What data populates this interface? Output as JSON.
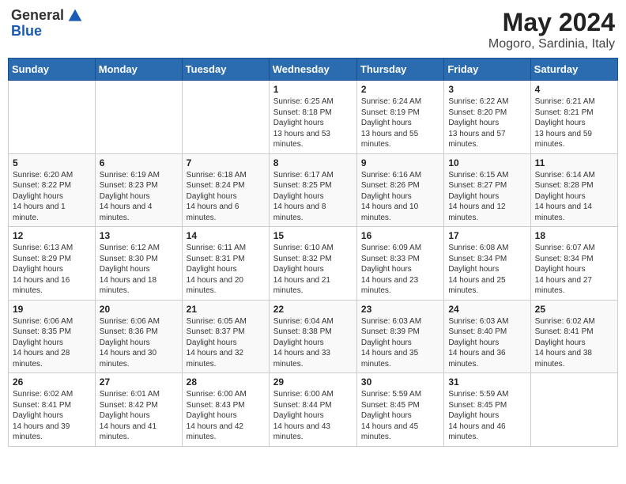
{
  "logo": {
    "general": "General",
    "blue": "Blue"
  },
  "title": {
    "month": "May 2024",
    "location": "Mogoro, Sardinia, Italy"
  },
  "days_of_week": [
    "Sunday",
    "Monday",
    "Tuesday",
    "Wednesday",
    "Thursday",
    "Friday",
    "Saturday"
  ],
  "weeks": [
    [
      {
        "day": null,
        "data": null
      },
      {
        "day": null,
        "data": null
      },
      {
        "day": null,
        "data": null
      },
      {
        "day": "1",
        "data": {
          "sunrise": "6:25 AM",
          "sunset": "8:18 PM",
          "daylight": "13 hours and 53 minutes."
        }
      },
      {
        "day": "2",
        "data": {
          "sunrise": "6:24 AM",
          "sunset": "8:19 PM",
          "daylight": "13 hours and 55 minutes."
        }
      },
      {
        "day": "3",
        "data": {
          "sunrise": "6:22 AM",
          "sunset": "8:20 PM",
          "daylight": "13 hours and 57 minutes."
        }
      },
      {
        "day": "4",
        "data": {
          "sunrise": "6:21 AM",
          "sunset": "8:21 PM",
          "daylight": "13 hours and 59 minutes."
        }
      }
    ],
    [
      {
        "day": "5",
        "data": {
          "sunrise": "6:20 AM",
          "sunset": "8:22 PM",
          "daylight": "14 hours and 1 minute."
        }
      },
      {
        "day": "6",
        "data": {
          "sunrise": "6:19 AM",
          "sunset": "8:23 PM",
          "daylight": "14 hours and 4 minutes."
        }
      },
      {
        "day": "7",
        "data": {
          "sunrise": "6:18 AM",
          "sunset": "8:24 PM",
          "daylight": "14 hours and 6 minutes."
        }
      },
      {
        "day": "8",
        "data": {
          "sunrise": "6:17 AM",
          "sunset": "8:25 PM",
          "daylight": "14 hours and 8 minutes."
        }
      },
      {
        "day": "9",
        "data": {
          "sunrise": "6:16 AM",
          "sunset": "8:26 PM",
          "daylight": "14 hours and 10 minutes."
        }
      },
      {
        "day": "10",
        "data": {
          "sunrise": "6:15 AM",
          "sunset": "8:27 PM",
          "daylight": "14 hours and 12 minutes."
        }
      },
      {
        "day": "11",
        "data": {
          "sunrise": "6:14 AM",
          "sunset": "8:28 PM",
          "daylight": "14 hours and 14 minutes."
        }
      }
    ],
    [
      {
        "day": "12",
        "data": {
          "sunrise": "6:13 AM",
          "sunset": "8:29 PM",
          "daylight": "14 hours and 16 minutes."
        }
      },
      {
        "day": "13",
        "data": {
          "sunrise": "6:12 AM",
          "sunset": "8:30 PM",
          "daylight": "14 hours and 18 minutes."
        }
      },
      {
        "day": "14",
        "data": {
          "sunrise": "6:11 AM",
          "sunset": "8:31 PM",
          "daylight": "14 hours and 20 minutes."
        }
      },
      {
        "day": "15",
        "data": {
          "sunrise": "6:10 AM",
          "sunset": "8:32 PM",
          "daylight": "14 hours and 21 minutes."
        }
      },
      {
        "day": "16",
        "data": {
          "sunrise": "6:09 AM",
          "sunset": "8:33 PM",
          "daylight": "14 hours and 23 minutes."
        }
      },
      {
        "day": "17",
        "data": {
          "sunrise": "6:08 AM",
          "sunset": "8:34 PM",
          "daylight": "14 hours and 25 minutes."
        }
      },
      {
        "day": "18",
        "data": {
          "sunrise": "6:07 AM",
          "sunset": "8:34 PM",
          "daylight": "14 hours and 27 minutes."
        }
      }
    ],
    [
      {
        "day": "19",
        "data": {
          "sunrise": "6:06 AM",
          "sunset": "8:35 PM",
          "daylight": "14 hours and 28 minutes."
        }
      },
      {
        "day": "20",
        "data": {
          "sunrise": "6:06 AM",
          "sunset": "8:36 PM",
          "daylight": "14 hours and 30 minutes."
        }
      },
      {
        "day": "21",
        "data": {
          "sunrise": "6:05 AM",
          "sunset": "8:37 PM",
          "daylight": "14 hours and 32 minutes."
        }
      },
      {
        "day": "22",
        "data": {
          "sunrise": "6:04 AM",
          "sunset": "8:38 PM",
          "daylight": "14 hours and 33 minutes."
        }
      },
      {
        "day": "23",
        "data": {
          "sunrise": "6:03 AM",
          "sunset": "8:39 PM",
          "daylight": "14 hours and 35 minutes."
        }
      },
      {
        "day": "24",
        "data": {
          "sunrise": "6:03 AM",
          "sunset": "8:40 PM",
          "daylight": "14 hours and 36 minutes."
        }
      },
      {
        "day": "25",
        "data": {
          "sunrise": "6:02 AM",
          "sunset": "8:41 PM",
          "daylight": "14 hours and 38 minutes."
        }
      }
    ],
    [
      {
        "day": "26",
        "data": {
          "sunrise": "6:02 AM",
          "sunset": "8:41 PM",
          "daylight": "14 hours and 39 minutes."
        }
      },
      {
        "day": "27",
        "data": {
          "sunrise": "6:01 AM",
          "sunset": "8:42 PM",
          "daylight": "14 hours and 41 minutes."
        }
      },
      {
        "day": "28",
        "data": {
          "sunrise": "6:00 AM",
          "sunset": "8:43 PM",
          "daylight": "14 hours and 42 minutes."
        }
      },
      {
        "day": "29",
        "data": {
          "sunrise": "6:00 AM",
          "sunset": "8:44 PM",
          "daylight": "14 hours and 43 minutes."
        }
      },
      {
        "day": "30",
        "data": {
          "sunrise": "5:59 AM",
          "sunset": "8:45 PM",
          "daylight": "14 hours and 45 minutes."
        }
      },
      {
        "day": "31",
        "data": {
          "sunrise": "5:59 AM",
          "sunset": "8:45 PM",
          "daylight": "14 hours and 46 minutes."
        }
      },
      {
        "day": null,
        "data": null
      }
    ]
  ]
}
